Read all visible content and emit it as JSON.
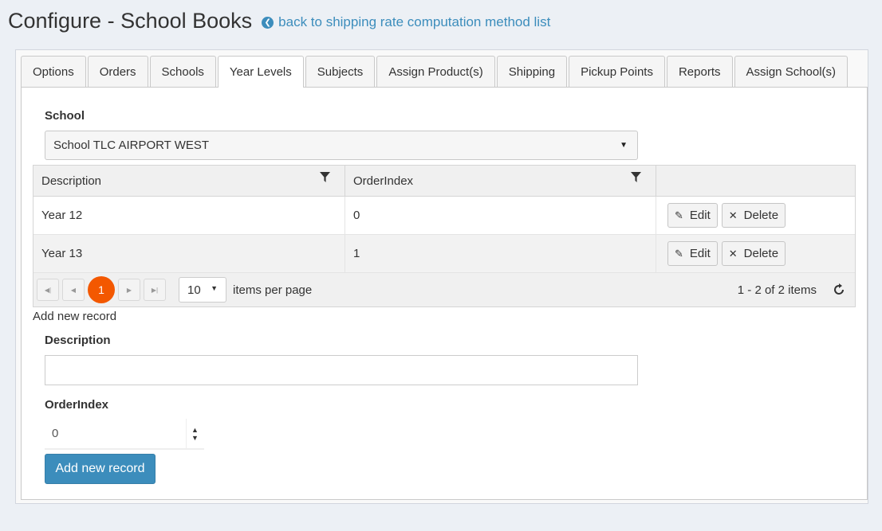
{
  "header": {
    "title": "Configure - School Books",
    "back_link": "back to shipping rate computation method list"
  },
  "tabs": [
    {
      "label": "Options"
    },
    {
      "label": "Orders"
    },
    {
      "label": "Schools"
    },
    {
      "label": "Year Levels",
      "active": true
    },
    {
      "label": "Subjects"
    },
    {
      "label": "Assign Product(s)"
    },
    {
      "label": "Shipping"
    },
    {
      "label": "Pickup Points"
    },
    {
      "label": "Reports"
    },
    {
      "label": "Assign School(s)"
    }
  ],
  "school": {
    "label": "School",
    "selected": "School TLC AIRPORT WEST"
  },
  "grid": {
    "columns": {
      "description": "Description",
      "order_index": "OrderIndex"
    },
    "rows": [
      {
        "description": "Year 12",
        "order_index": "0"
      },
      {
        "description": "Year 13",
        "order_index": "1"
      }
    ],
    "edit_label": "Edit",
    "delete_label": "Delete",
    "pager": {
      "current_page": "1",
      "page_size": "10",
      "items_per_page_label": "items per page",
      "info": "1 - 2 of 2 items"
    }
  },
  "add_form": {
    "caption": "Add new record",
    "description_label": "Description",
    "description_value": "",
    "order_index_label": "OrderIndex",
    "order_index_value": "0",
    "submit_label": "Add new record"
  },
  "colors": {
    "accent": "#3c8dbc",
    "pager_current": "#f35800"
  }
}
